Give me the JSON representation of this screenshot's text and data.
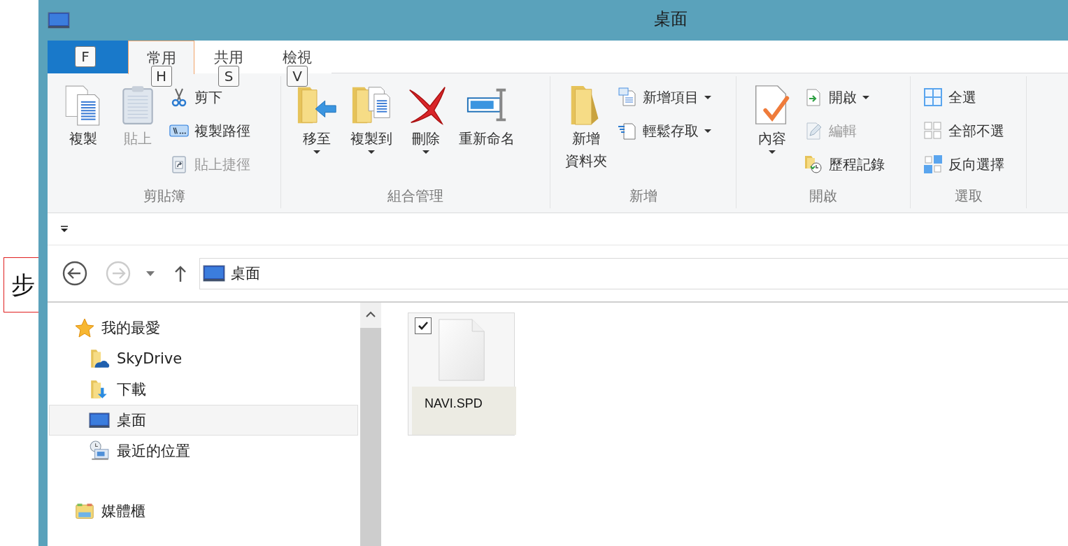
{
  "behind": {
    "text": "步"
  },
  "window": {
    "title": "桌面"
  },
  "tabs": [
    {
      "kind": "file",
      "keytip": "F",
      "selected": false
    },
    {
      "label": "常用",
      "kind": "tab",
      "keytip": "H",
      "selected": true
    },
    {
      "label": "共用",
      "kind": "tab",
      "keytip": "S",
      "selected": false
    },
    {
      "label": "檢視",
      "kind": "tab",
      "keytip": "V",
      "selected": false
    }
  ],
  "ribbon": {
    "groups": [
      {
        "label": "剪貼簿",
        "items": [
          {
            "kind": "large",
            "lines": [
              "複製"
            ],
            "dropdown": false,
            "disabled": false
          },
          {
            "kind": "large",
            "lines": [
              "貼上"
            ],
            "dropdown": false,
            "disabled": true
          },
          {
            "kind": "stack",
            "items": [
              {
                "label": "剪下",
                "dropdown": false,
                "disabled": false
              },
              {
                "label": "複製路徑",
                "dropdown": false,
                "disabled": false
              },
              {
                "label": "貼上捷徑",
                "dropdown": false,
                "disabled": true
              }
            ]
          }
        ]
      },
      {
        "label": "組合管理",
        "items": [
          {
            "kind": "large",
            "lines": [
              "移至"
            ],
            "dropdown": true,
            "disabled": false
          },
          {
            "kind": "large",
            "lines": [
              "複製到"
            ],
            "dropdown": true,
            "disabled": false
          },
          {
            "kind": "large",
            "lines": [
              "刪除"
            ],
            "dropdown": true,
            "disabled": false
          },
          {
            "kind": "large",
            "lines": [
              "重新命名"
            ],
            "dropdown": false,
            "disabled": false
          }
        ]
      },
      {
        "label": "新增",
        "items": [
          {
            "kind": "large",
            "lines": [
              "新增",
              "資料夾"
            ],
            "dropdown": false,
            "disabled": false
          },
          {
            "kind": "stack",
            "items": [
              {
                "label": "新增項目",
                "dropdown": true,
                "disabled": false
              },
              {
                "label": "輕鬆存取",
                "dropdown": true,
                "disabled": false
              }
            ]
          }
        ]
      },
      {
        "label": "開啟",
        "items": [
          {
            "kind": "large",
            "lines": [
              "內容"
            ],
            "dropdown": true,
            "disabled": false
          },
          {
            "kind": "stack",
            "items": [
              {
                "label": "開啟",
                "dropdown": true,
                "disabled": false
              },
              {
                "label": "編輯",
                "dropdown": false,
                "disabled": true
              },
              {
                "label": "歷程記錄",
                "dropdown": false,
                "disabled": false
              }
            ]
          }
        ]
      },
      {
        "label": "選取",
        "items": [
          {
            "kind": "stack",
            "items": [
              {
                "label": "全選",
                "dropdown": false,
                "disabled": false
              },
              {
                "label": "全部不選",
                "dropdown": false,
                "disabled": false
              },
              {
                "label": "反向選擇",
                "dropdown": false,
                "disabled": false
              }
            ]
          }
        ]
      }
    ]
  },
  "navigation": {
    "back_enabled": true,
    "forward_enabled": false
  },
  "address": {
    "value": "桌面"
  },
  "sidebar": {
    "items": [
      {
        "label": "我的最愛",
        "selected": false,
        "children": [
          {
            "label": "SkyDrive",
            "selected": false
          },
          {
            "label": "下載",
            "selected": false
          },
          {
            "label": "桌面",
            "selected": true
          },
          {
            "label": "最近的位置",
            "selected": false
          }
        ]
      },
      {
        "label": "媒體櫃",
        "selected": false
      }
    ]
  },
  "files": [
    {
      "name": "NAVI.SPD",
      "checked": true,
      "selected": true
    }
  ]
}
